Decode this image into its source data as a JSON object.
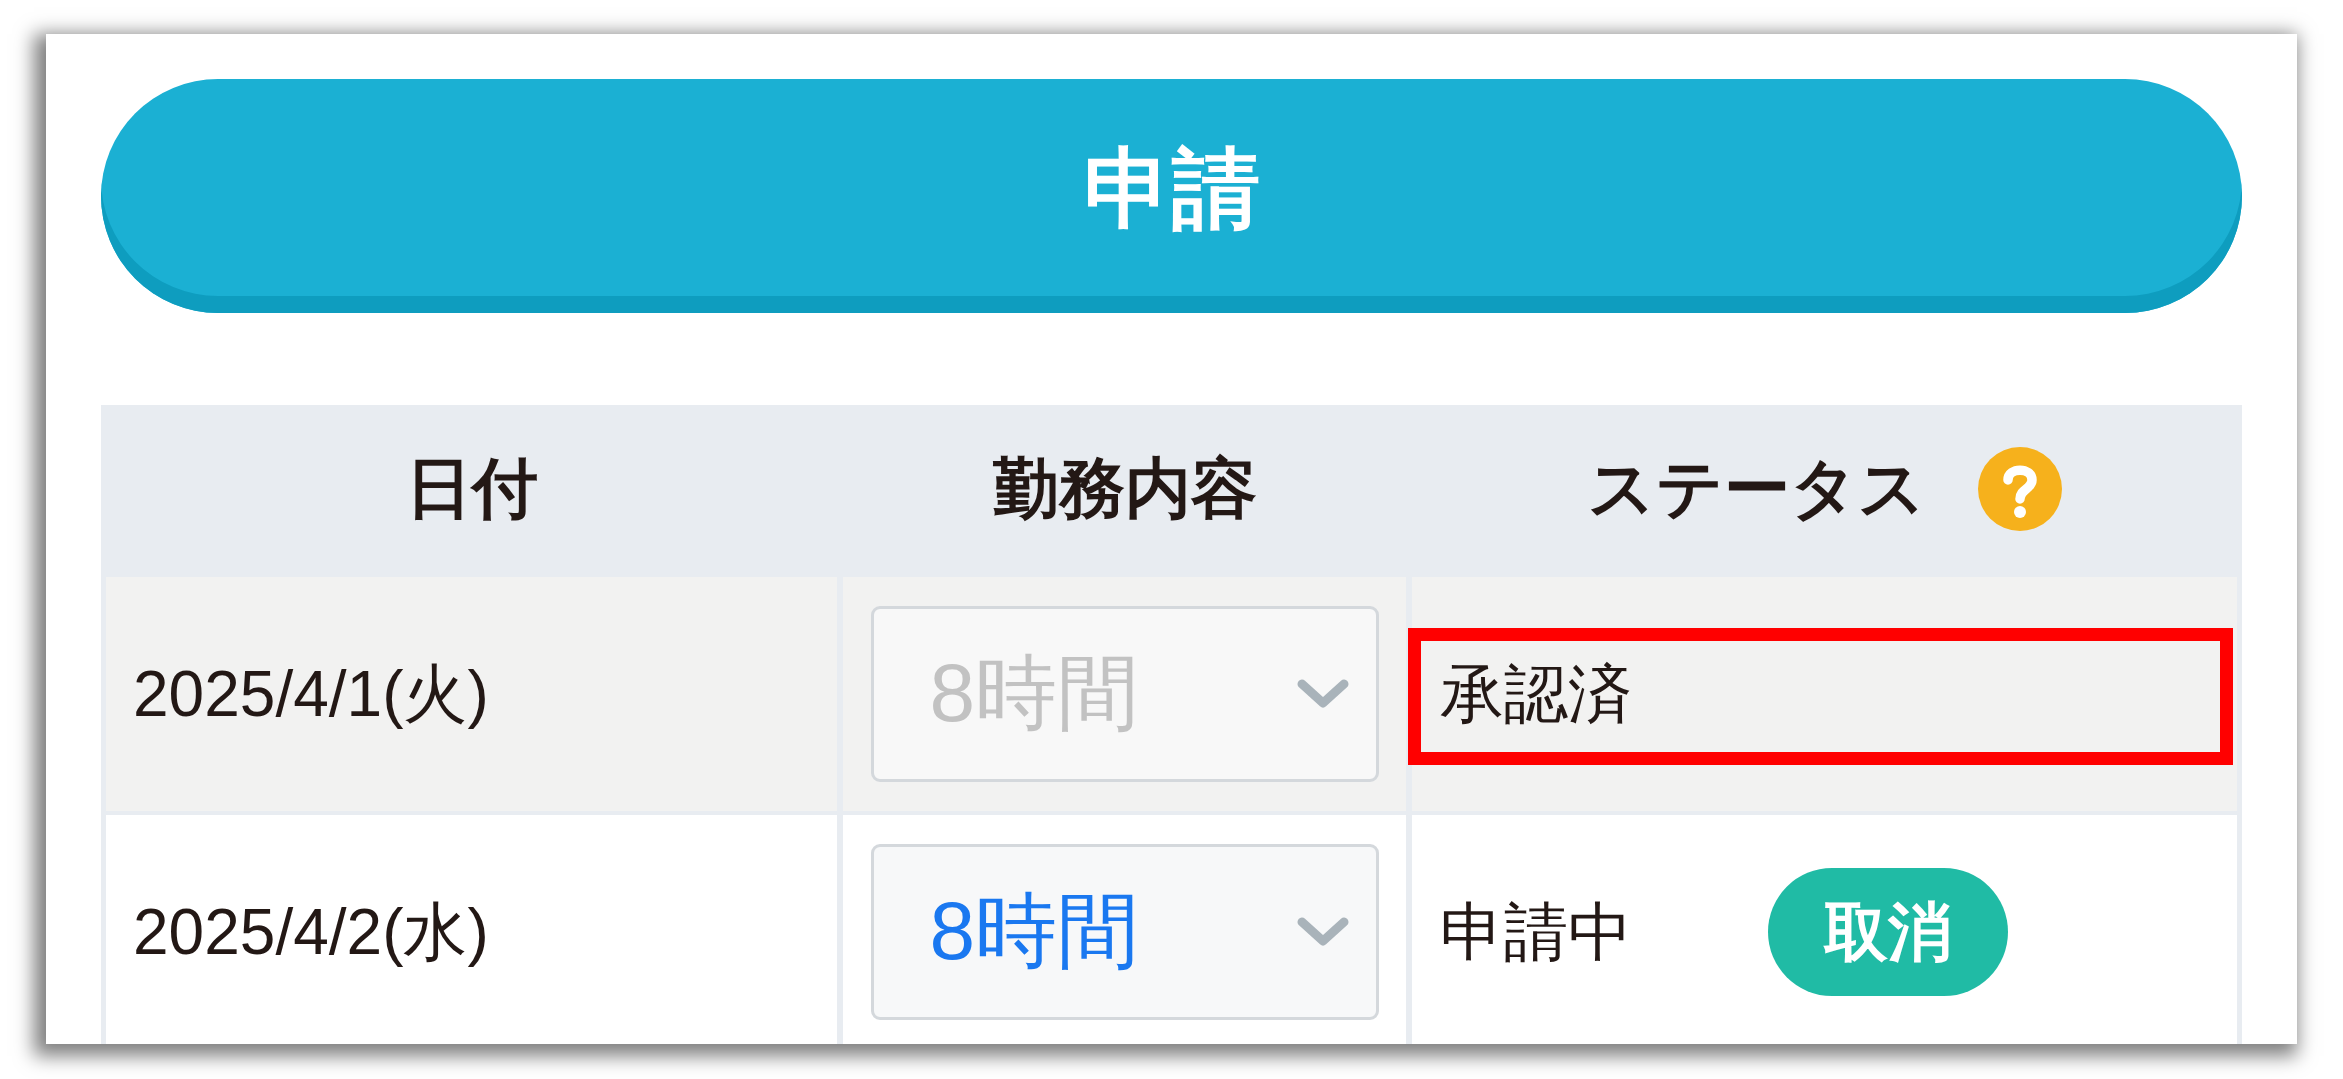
{
  "apply_button": {
    "label": "申請"
  },
  "table": {
    "columns": [
      {
        "label": "日付",
        "help_icon": false
      },
      {
        "label": "勤務内容",
        "help_icon": false
      },
      {
        "label": "ステータス",
        "help_icon": true
      }
    ],
    "rows": [
      {
        "date": "2025/4/1(火)",
        "work": "8時間",
        "disabled": true,
        "status": "承認済",
        "highlighted": true
      },
      {
        "date": "2025/4/2(水)",
        "work": "8時間",
        "disabled": false,
        "status": "申請中",
        "highlighted": false,
        "action": "取消"
      }
    ]
  }
}
